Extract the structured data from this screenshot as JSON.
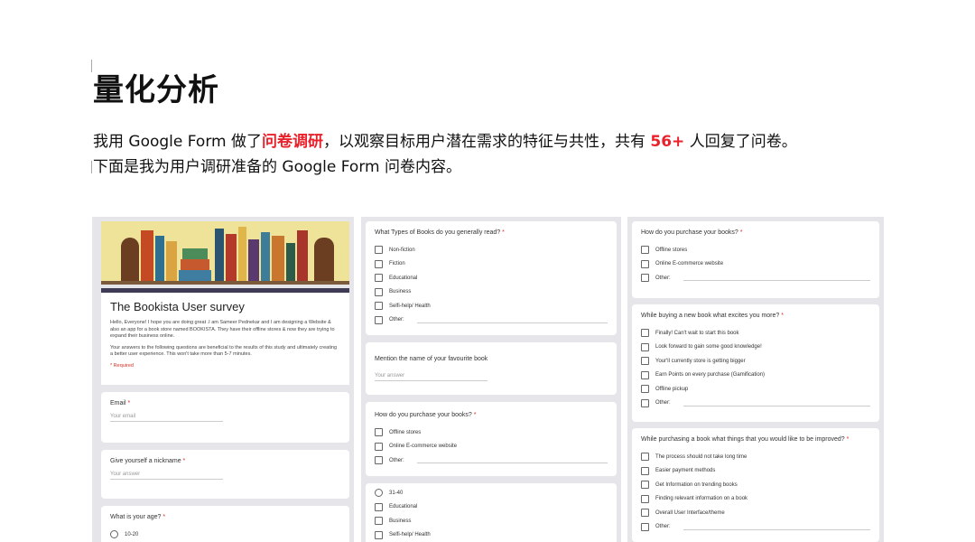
{
  "slide": {
    "title": "量化分析",
    "intro": {
      "p1": "我用 Google Form 做了",
      "hl": "问卷调研",
      "p2": "，以观察目标用户潜在需求的特征与共性，共有 ",
      "num": "56+",
      "p3": " 人回复了问卷。",
      "line2": "下面是我为用户调研准备的 Google Form 问卷内容。"
    },
    "accent_color": "#e8212b"
  },
  "form": {
    "title": "The Bookista User survey",
    "desc1": "Hello, Everyone! I hope you are doing great .I am Sameer Pednekar and I am designing a Website & also an app for a book store named BOOKISTA. They have their offline stores & now they are trying to expand their business online.",
    "desc2": "Your answers to the following questions are beneficial to the results of this study and ultimately creating a better user experience. This won't take more than 5-7 minutes.",
    "required_note": "* Required",
    "email_q": "Email",
    "email_ph": "Your email",
    "nick_q": "Give yourself a nickname",
    "nick_ph": "Your answer",
    "age_q": "What is your age?",
    "age_opt1": "10-20",
    "req_mark": "*"
  },
  "col2": {
    "types_q": "What Types of Books do you generally read?",
    "types_opts": [
      "Non-fiction",
      "Fiction",
      "Educational",
      "Business",
      "Selfi-help/ Health",
      "Other:"
    ],
    "fav_q": "Mention the name of your favourite book",
    "fav_ph": "Your answer",
    "purchase_q": "How do you purchase your books?",
    "purchase_opts": [
      "Offline stores",
      "Online E-commerce website",
      "Other:"
    ],
    "tail_radio": "31-40",
    "tail_opts": [
      "Educational",
      "Business",
      "Selfi-help/ Health"
    ]
  },
  "col3": {
    "purchase_q": "How do you purchase your books?",
    "purchase_opts": [
      "Offline stores",
      "Online E-commerce website",
      "Other:"
    ],
    "excite_q": "While buying a new book what excites you more?",
    "excite_opts": [
      "Finally! Can't wait to start this book",
      "Look forward to gain some good knowledge!",
      "Your'll currently store is getting bigger",
      "Earn Points on every purchase (Gamification)",
      "Offline pickup",
      "Other:"
    ],
    "improve_q": "While purchasing a book what things that you would like to be improved?",
    "improve_opts": [
      "The process should not take long time",
      "Easier payment methods",
      "Get Information on trending books",
      "Finding relevant information on a book",
      "Overall User Interface/theme",
      "Other:"
    ]
  }
}
